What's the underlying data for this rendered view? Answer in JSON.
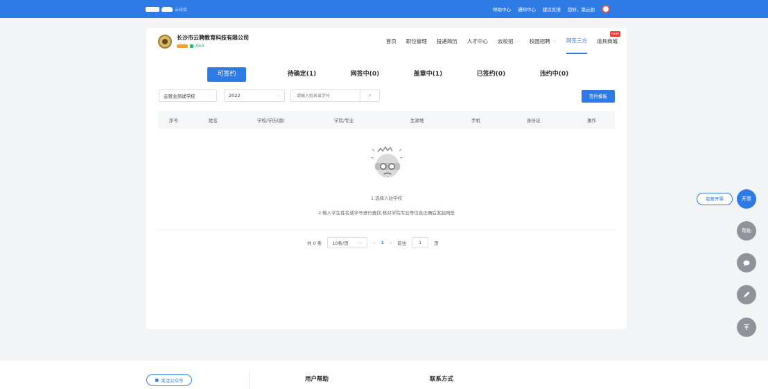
{
  "topbar": {
    "logo_text": "云校招",
    "links": [
      "帮助中心",
      "通知中心",
      "建议反馈",
      "您好，葉云勁"
    ]
  },
  "company": {
    "name": "长沙市云聘教育科技有限公司",
    "rating": "AAA"
  },
  "nav": {
    "items": [
      {
        "label": "首页"
      },
      {
        "label": "职位管理"
      },
      {
        "label": "投递简历"
      },
      {
        "label": "人才中心"
      },
      {
        "label": "云校招"
      },
      {
        "label": "校园招聘"
      },
      {
        "label": "网签三方"
      },
      {
        "label": "道具商城"
      }
    ],
    "new_tag": "new",
    "active": "网签三方"
  },
  "tabs": [
    "可签约",
    "待确定(1)",
    "网签中(0)",
    "盖章中(1)",
    "已签约(0)",
    "违约中(0)"
  ],
  "filters": {
    "school": "云就业测试学校",
    "year": "2022",
    "search_placeholder": "请输入姓名或学号",
    "template_button": "签约模板"
  },
  "table": {
    "columns": [
      "序号",
      "姓名",
      "学校/学历(届)",
      "学院/专业",
      "生源地",
      "手机",
      "身份证",
      "操作"
    ]
  },
  "empty": {
    "line1": "1.选择入驻学校",
    "line2": "2.输入学生姓名或学号进行查找,核对学院专业等信息正确后发起网签"
  },
  "pagination": {
    "total": "共 0 条",
    "page_size": "10条/页",
    "current": "1",
    "goto_label": "前往",
    "goto_value": "1",
    "page_unit": "页"
  },
  "floating": {
    "invoice_link": "我要开票",
    "invoice_fab": "开票",
    "help": "帮助"
  },
  "footer": {
    "follow": "关注公众号",
    "user_help": "用户帮助",
    "contact": "联系方式"
  },
  "colors": {
    "primary": "#2f7be5",
    "new_tag": "#e53935",
    "rating": "#2dbb6f"
  }
}
